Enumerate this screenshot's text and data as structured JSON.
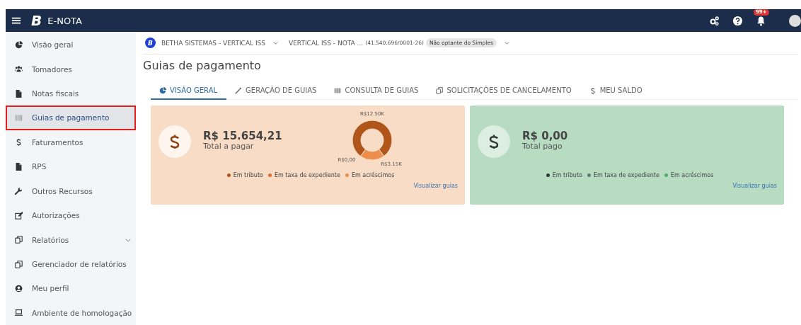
{
  "app_bar": {
    "title": "E-NOTA",
    "logo_letter": "B",
    "notification_badge": "99+"
  },
  "sidebar": {
    "items": [
      {
        "label": "Visão geral",
        "selected": false,
        "expandable": false
      },
      {
        "label": "Tomadores",
        "selected": false,
        "expandable": false
      },
      {
        "label": "Notas fiscais",
        "selected": false,
        "expandable": false
      },
      {
        "label": "Guias de pagamento",
        "selected": true,
        "expandable": false
      },
      {
        "label": "Faturamentos",
        "selected": false,
        "expandable": false
      },
      {
        "label": "RPS",
        "selected": false,
        "expandable": false
      },
      {
        "label": "Outros Recursos",
        "selected": false,
        "expandable": false
      },
      {
        "label": "Autorizações",
        "selected": false,
        "expandable": false
      },
      {
        "label": "Relatórios",
        "selected": false,
        "expandable": true
      },
      {
        "label": "Gerenciador de relatórios",
        "selected": false,
        "expandable": false
      },
      {
        "label": "Meu perfil",
        "selected": false,
        "expandable": false
      },
      {
        "label": "Ambiente de homologação",
        "selected": false,
        "expandable": false
      }
    ]
  },
  "context_bar": {
    "entity_letter": "B",
    "entity": "BETHA SISTEMAS - VERTICAL ISS",
    "company": "VERTICAL ISS - NOTA ...",
    "cnpj": "(41.540.696/0001-26)",
    "regime_badge": "Não optante do Simples"
  },
  "page_title": "Guias de pagamento",
  "tabs": [
    {
      "label": "VISÃO GERAL",
      "selected": true
    },
    {
      "label": "GERAÇÃO DE GUIAS",
      "selected": false
    },
    {
      "label": "CONSULTA DE GUIAS",
      "selected": false
    },
    {
      "label": "SOLICITAÇÕES DE CANCELAMENTO",
      "selected": false
    },
    {
      "label": "MEU SALDO",
      "selected": false
    }
  ],
  "cards": [
    {
      "kind": "to_pay",
      "color": "#f8dcc6",
      "amount": "R$ 15.654,21",
      "caption": "Total a pagar",
      "legend": [
        {
          "label": "Em tributo",
          "color": "#b0561a"
        },
        {
          "label": "Em taxa de expediente",
          "color": "#d9702e"
        },
        {
          "label": "Em acréscimos",
          "color": "#ec8d4c"
        }
      ],
      "chart_data": {
        "type": "donut",
        "values": [
          12500,
          0,
          3150
        ],
        "value_labels": [
          "R$12.50K",
          "R$0,00",
          "R$3.15K"
        ]
      },
      "link": "Visualizar guias"
    },
    {
      "kind": "paid",
      "color": "#b7dcc2",
      "amount": "R$ 0,00",
      "caption": "Total pago",
      "legend": [
        {
          "label": "Em tributo",
          "color": "#2f3d35"
        },
        {
          "label": "Em taxa de expediente",
          "color": "#5f7b68"
        },
        {
          "label": "Em acréscimos",
          "color": "#4fae6a"
        }
      ],
      "link": "Visualizar guias"
    }
  ]
}
